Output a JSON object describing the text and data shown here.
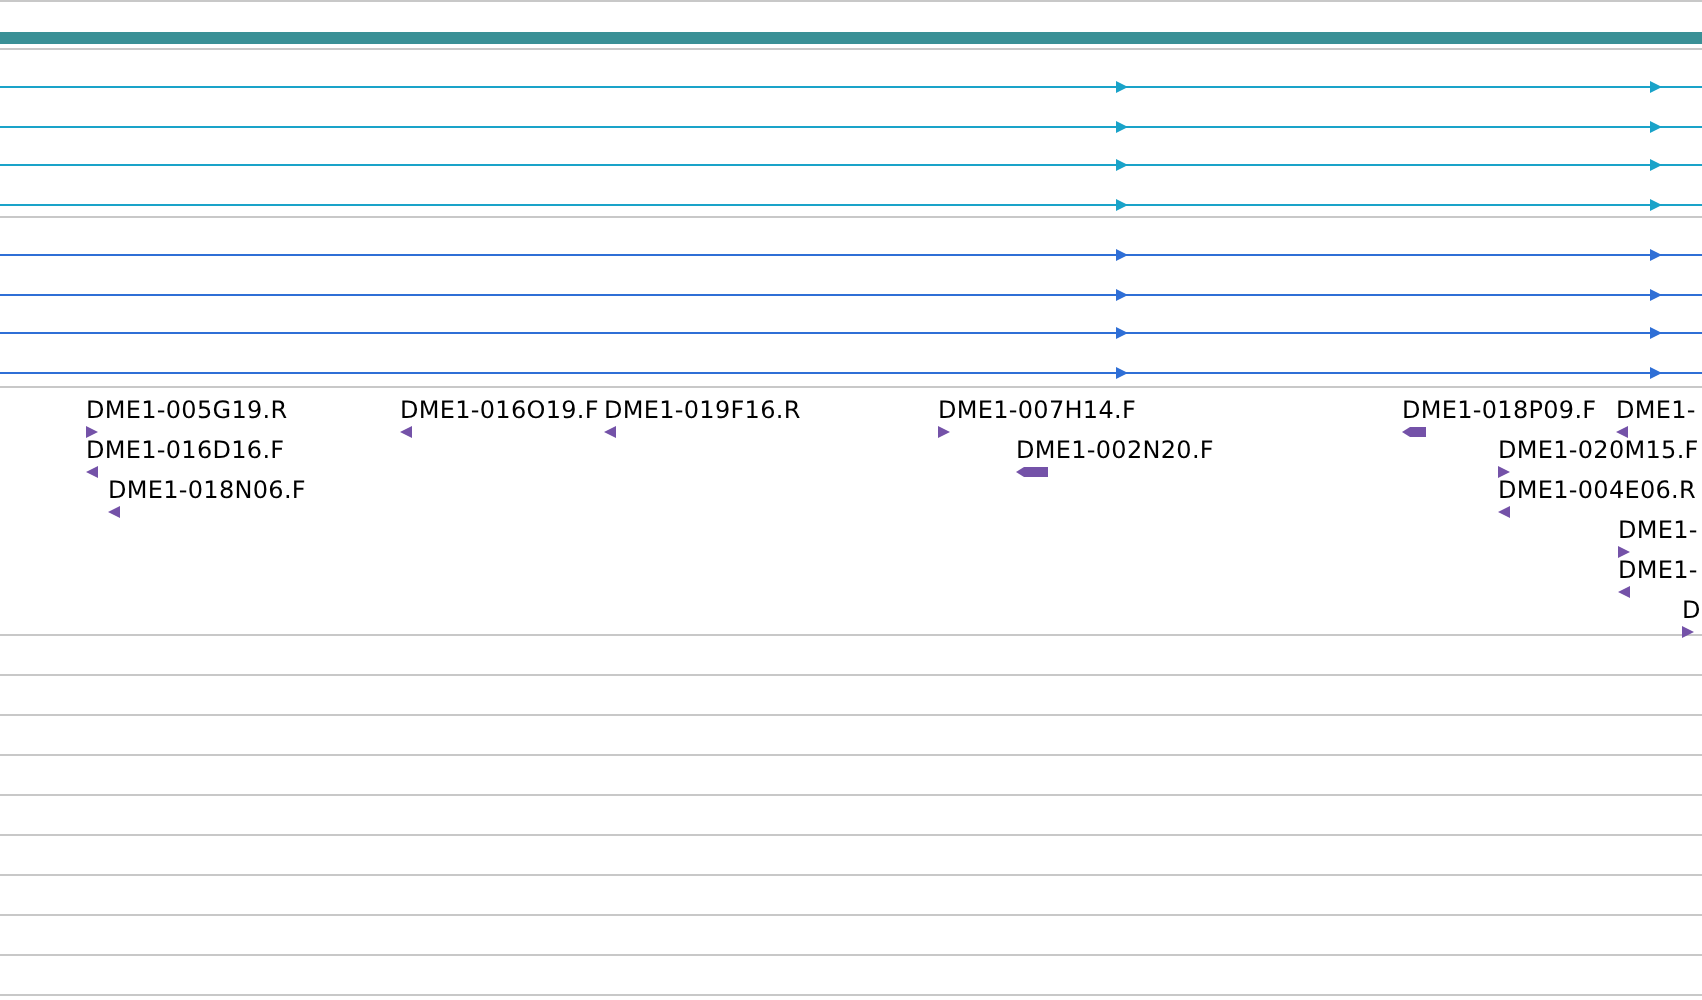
{
  "features": [
    {
      "label": "DME1-005G19.R",
      "reverse": false
    },
    {
      "label": "DME1-016D16.F",
      "reverse": true
    },
    {
      "label": "DME1-018N06.F",
      "reverse": true
    },
    {
      "label": "DME1-016O19.F",
      "reverse": true
    },
    {
      "label": "DME1-019F16.R",
      "reverse": true
    },
    {
      "label": "DME1-007H14.F",
      "reverse": false
    },
    {
      "label": "DME1-002N20.F",
      "reverse": true
    },
    {
      "label": "DME1-018P09.F",
      "reverse": true
    },
    {
      "label": "DME1-",
      "reverse": true
    },
    {
      "label": "DME1-020M15.F",
      "reverse": false
    },
    {
      "label": "DME1-004E06.R",
      "reverse": true
    },
    {
      "label": "DME1-",
      "reverse": false
    },
    {
      "label": "DME1-",
      "reverse": true
    },
    {
      "label": "D",
      "reverse": false
    }
  ]
}
